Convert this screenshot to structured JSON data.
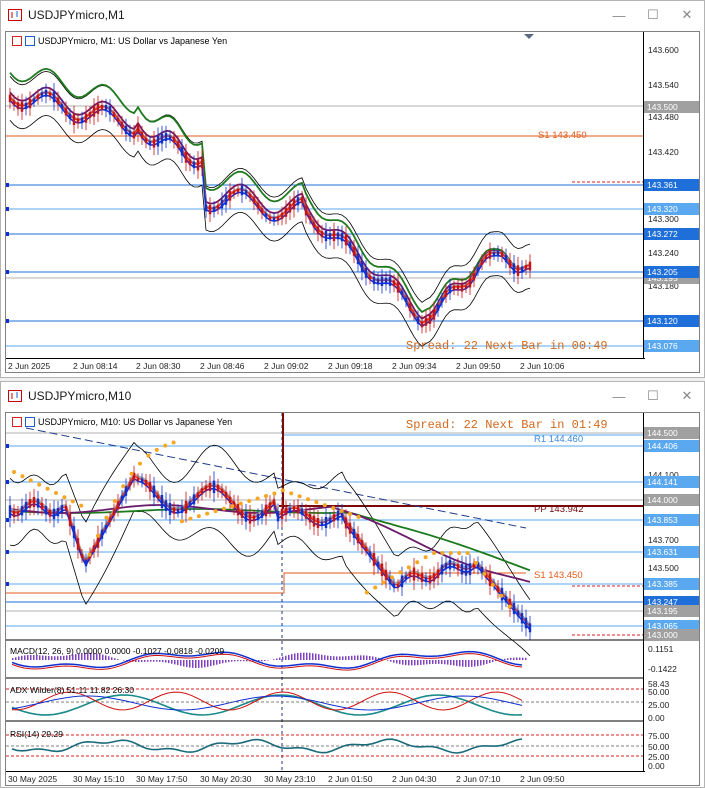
{
  "window1": {
    "title": "USDJPYmicro,M1",
    "header": "USDJPYmicro, M1:  US Dollar vs Japanese Yen",
    "spread": "Spread: 22  Next Bar in 00:49",
    "s1": "S1 143.450",
    "price_labels": [
      "143.600",
      "143.540",
      "143.480",
      "143.420",
      "143.300",
      "143.240",
      "143.180"
    ],
    "price_tags": [
      {
        "text": "143.500",
        "color": "#a0a0a0"
      },
      {
        "text": "143.361",
        "color": "#1e6fd9"
      },
      {
        "text": "143.320",
        "color": "#5aa8f0"
      },
      {
        "text": "143.272",
        "color": "#1e6fd9"
      },
      {
        "text": "143.205",
        "color": "#1e6fd9"
      },
      {
        "text": "143.195",
        "color": "#a0a0a0"
      },
      {
        "text": "143.120",
        "color": "#1e6fd9"
      },
      {
        "text": "143.076",
        "color": "#5aa8f0"
      }
    ],
    "time_labels": [
      "2 Jun 2025",
      "2 Jun 08:14",
      "2 Jun 08:30",
      "2 Jun 08:46",
      "2 Jun 09:02",
      "2 Jun 09:18",
      "2 Jun 09:34",
      "2 Jun 09:50",
      "2 Jun 10:06"
    ]
  },
  "window2": {
    "title": "USDJPYmicro,M10",
    "header": "USDJPYmicro, M10:  US Dollar vs Japanese Yen",
    "spread": "Spread: 22  Next Bar in 01:49",
    "r1": "R1 144.460",
    "pp": "PP 143.942",
    "s1": "S1 143.450",
    "price_labels": [
      "144.100",
      "143.700",
      "143.500"
    ],
    "price_tags": [
      {
        "text": "144.500",
        "color": "#a0a0a0"
      },
      {
        "text": "144.406",
        "color": "#5aa8f0"
      },
      {
        "text": "144.141",
        "color": "#5aa8f0"
      },
      {
        "text": "144.000",
        "color": "#a0a0a0"
      },
      {
        "text": "143.853",
        "color": "#5aa8f0"
      },
      {
        "text": "143.631",
        "color": "#5aa8f0"
      },
      {
        "text": "143.385",
        "color": "#5aa8f0"
      },
      {
        "text": "143.247",
        "color": "#1e6fd9"
      },
      {
        "text": "143.195",
        "color": "#a0a0a0"
      },
      {
        "text": "143.065",
        "color": "#5aa8f0"
      },
      {
        "text": "143.000",
        "color": "#a0a0a0"
      }
    ],
    "macd": {
      "label": "MACD(12, 26, 9)  0.0000  0.0000  -0.1027  -0.0818  -0.0209",
      "top": "0.1151",
      "bottom": "-0.1422"
    },
    "adx": {
      "label": "ADX Wilder(8) 51.11  11.82  26.30",
      "levels": [
        "58.43",
        "50.00",
        "25.00",
        "0.00"
      ]
    },
    "rsi": {
      "label": "RSI(14) 29.29",
      "levels": [
        "75.00",
        "50.00",
        "25.00",
        "0.00"
      ]
    },
    "time_labels": [
      "30 May 2025",
      "30 May 15:10",
      "30 May 17:50",
      "30 May 20:30",
      "30 May 23:10",
      "2 Jun 01:50",
      "2 Jun 04:30",
      "2 Jun 07:10",
      "2 Jun 09:50"
    ]
  }
}
